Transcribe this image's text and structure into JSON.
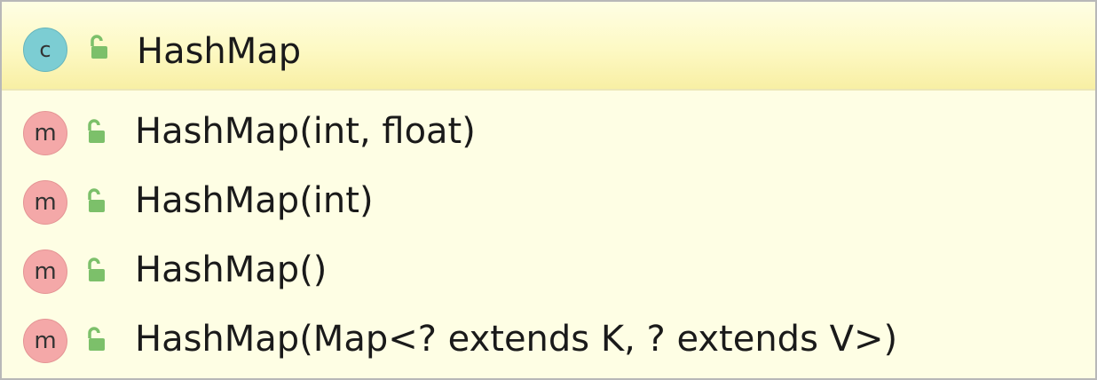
{
  "class_entry": {
    "badge_letter": "c",
    "icon": "class-icon",
    "visibility_icon": "public-unlock-icon",
    "name": "HashMap"
  },
  "methods": [
    {
      "badge_letter": "m",
      "icon": "method-icon",
      "visibility_icon": "public-unlock-icon",
      "signature": "HashMap(int, float)"
    },
    {
      "badge_letter": "m",
      "icon": "method-icon",
      "visibility_icon": "public-unlock-icon",
      "signature": "HashMap(int)"
    },
    {
      "badge_letter": "m",
      "icon": "method-icon",
      "visibility_icon": "public-unlock-icon",
      "signature": "HashMap()"
    },
    {
      "badge_letter": "m",
      "icon": "method-icon",
      "visibility_icon": "public-unlock-icon",
      "signature": "HashMap(Map<? extends K, ? extends V>)"
    }
  ],
  "colors": {
    "popup_background": "#fefee4",
    "header_highlight": "#fdf9c4",
    "class_badge": "#7ccdd3",
    "method_badge": "#f4a8a8",
    "lock_green": "#7cc06a"
  }
}
